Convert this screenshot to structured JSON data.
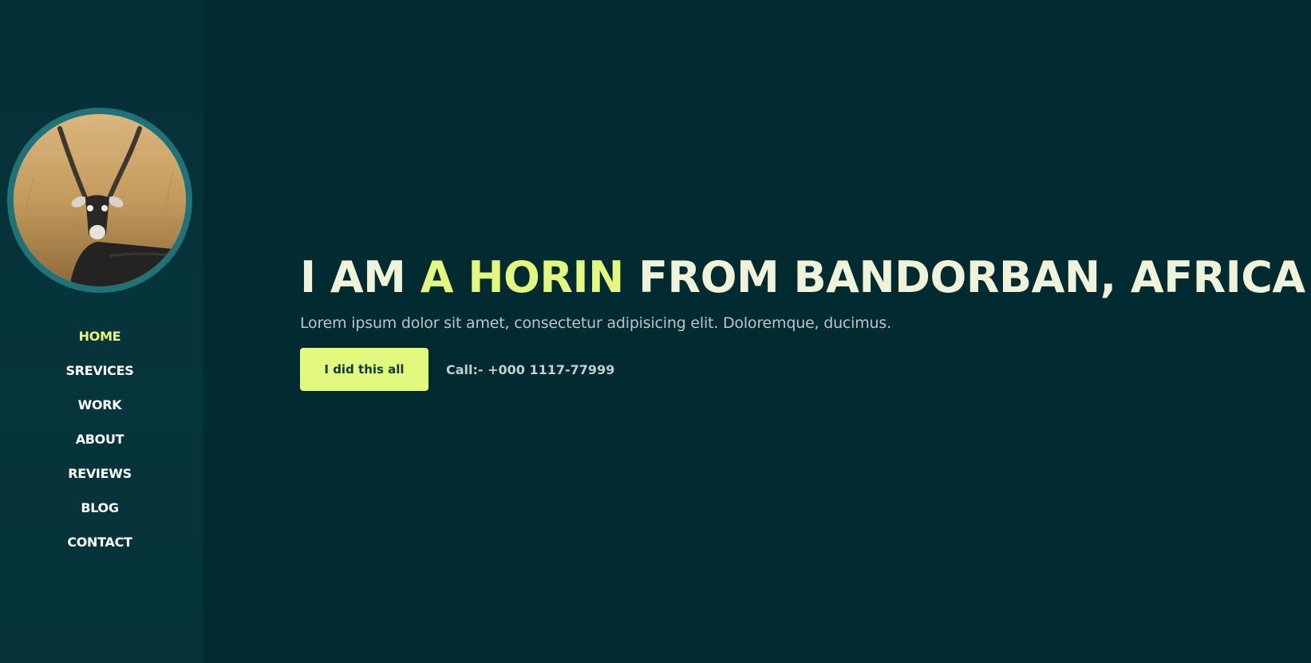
{
  "sidebar": {
    "avatar_alt": "Blackbuck antelope portrait",
    "nav": [
      {
        "label": "HOME",
        "active": true
      },
      {
        "label": "SREVICES",
        "active": false
      },
      {
        "label": "WORK",
        "active": false
      },
      {
        "label": "ABOUT",
        "active": false
      },
      {
        "label": "REVIEWS",
        "active": false
      },
      {
        "label": "BLOG",
        "active": false
      },
      {
        "label": "CONTACT",
        "active": false
      }
    ]
  },
  "hero": {
    "title_part1": "I AM ",
    "title_accent": "A HORIN",
    "title_part2": " FROM BANDORBAN, AFRICA",
    "subtitle": "Lorem ipsum dolor sit amet, consectetur adipisicing elit. Doloremque, ducimus.",
    "button_label": "I did this all",
    "call_text": "Call:- +000 1117-77999"
  },
  "colors": {
    "background": "#022a31",
    "accent": "#e2f87f",
    "avatar_ring": "#1e7278",
    "text_light": "#eef3d9"
  },
  "icons": {
    "avatar": "antelope-photo"
  }
}
